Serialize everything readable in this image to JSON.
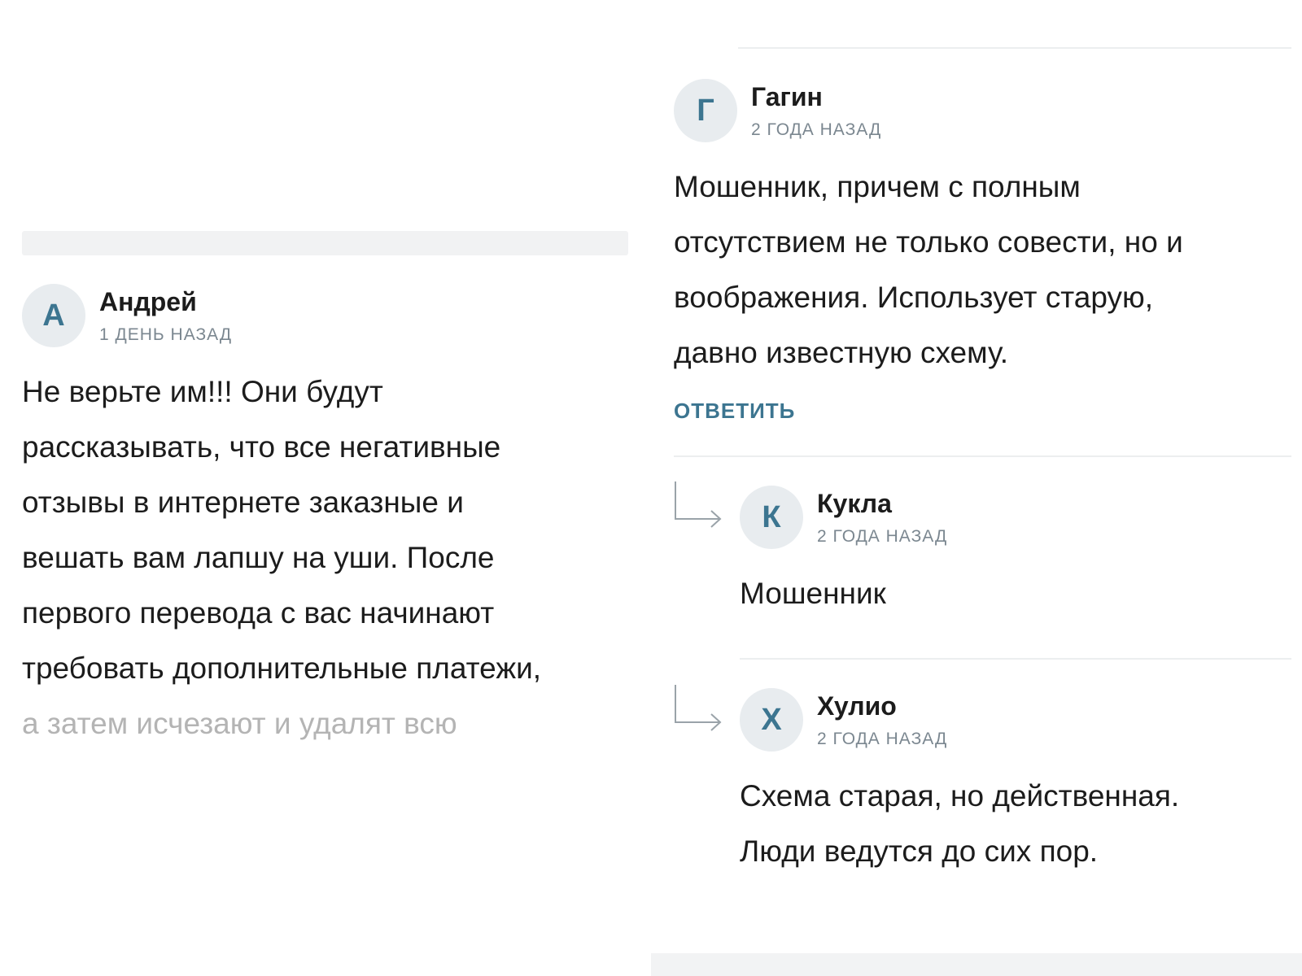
{
  "left": {
    "comment": {
      "avatar_letter": "А",
      "author": "Андрей",
      "time": "1 ДЕНЬ НАЗАД",
      "lines": [
        "Не верьте им!!! Они будут",
        "рассказывать, что все негативные",
        "отзывы в интернете заказные и",
        "вешать вам лапшу на уши. После",
        "первого перевода с вас начинают",
        "требовать дополнительные платежи,"
      ],
      "faded_line": "а затем исчезают и удалят всю"
    }
  },
  "right": {
    "partial_top_text": "...",
    "main_comment": {
      "avatar_letter": "Г",
      "author": "Гагин",
      "time": "2 ГОДА НАЗАД",
      "lines": [
        "Мошенник, причем с полным",
        "отсутствием не только совести, но и",
        "воображения. Использует старую,",
        "давно известную схему."
      ],
      "reply_label": "ОТВЕТИТЬ"
    },
    "replies": [
      {
        "avatar_letter": "К",
        "author": "Кукла",
        "time": "2 ГОДА НАЗАД",
        "lines": [
          "Мошенник"
        ]
      },
      {
        "avatar_letter": "Х",
        "author": "Хулио",
        "time": "2 ГОДА НАЗАД",
        "lines": [
          "Схема старая, но действенная.",
          "Люди ведутся до сих пор."
        ]
      }
    ]
  },
  "colors": {
    "accent": "#3c7590",
    "avatar_bg": "#e8ecef",
    "muted": "#7b8790"
  }
}
